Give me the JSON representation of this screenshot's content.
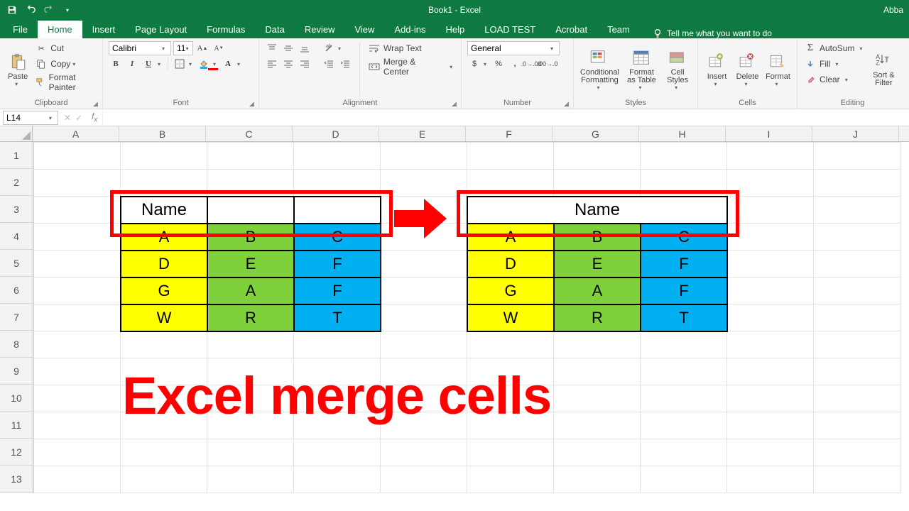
{
  "titlebar": {
    "title": "Book1 - Excel",
    "user": "Abba"
  },
  "tabs": {
    "items": [
      "File",
      "Home",
      "Insert",
      "Page Layout",
      "Formulas",
      "Data",
      "Review",
      "View",
      "Add-ins",
      "Help",
      "LOAD TEST",
      "Acrobat",
      "Team"
    ],
    "active": "Home",
    "tell_me": "Tell me what you want to do"
  },
  "ribbon": {
    "clipboard": {
      "paste": "Paste",
      "cut": "Cut",
      "copy": "Copy",
      "format_painter": "Format Painter",
      "label": "Clipboard"
    },
    "font": {
      "name": "Calibri",
      "size": "11",
      "label": "Font"
    },
    "alignment": {
      "wrap": "Wrap Text",
      "merge": "Merge & Center",
      "label": "Alignment"
    },
    "number": {
      "format": "General",
      "label": "Number"
    },
    "styles": {
      "cf": "Conditional Formatting",
      "fat": "Format as Table",
      "cs": "Cell Styles",
      "label": "Styles"
    },
    "cells": {
      "insert": "Insert",
      "delete": "Delete",
      "format": "Format",
      "label": "Cells"
    },
    "editing": {
      "autosum": "AutoSum",
      "fill": "Fill",
      "clear": "Clear",
      "sort": "Sort & Filter",
      "label": "Editing"
    }
  },
  "formula_bar": {
    "namebox": "L14"
  },
  "columns": [
    "A",
    "B",
    "C",
    "D",
    "E",
    "F",
    "G",
    "H",
    "I",
    "J"
  ],
  "rows": [
    "1",
    "2",
    "3",
    "4",
    "5",
    "6",
    "7",
    "8",
    "9",
    "10",
    "11",
    "12",
    "13"
  ],
  "left_table": {
    "header": "Name",
    "data": [
      [
        "A",
        "B",
        "C"
      ],
      [
        "D",
        "E",
        "F"
      ],
      [
        "G",
        "A",
        "F"
      ],
      [
        "W",
        "R",
        "T"
      ]
    ]
  },
  "right_table": {
    "header": "Name",
    "data": [
      [
        "A",
        "B",
        "C"
      ],
      [
        "D",
        "E",
        "F"
      ],
      [
        "G",
        "A",
        "F"
      ],
      [
        "W",
        "R",
        "T"
      ]
    ]
  },
  "caption": "Excel merge cells"
}
